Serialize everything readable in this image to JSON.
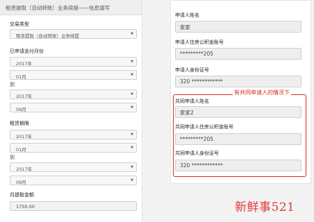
{
  "left_panel": {
    "header": "租赁提取（自动转账）业务续提——信息填写",
    "transaction_type": {
      "label": "交易类型",
      "value": "租赁提取（自动转账）业务续提"
    },
    "paid_month": {
      "label": "已申请支付月份",
      "start_year": "2017年",
      "start_month": "01月",
      "to": "到",
      "end_year": "2017年",
      "end_month": "09月"
    },
    "lease_period": {
      "label": "租赁期限",
      "start_year": "2017年",
      "start_month": "01月",
      "to": "到",
      "end_year": "2017年",
      "end_month": "09月"
    },
    "monthly_amount": {
      "label": "月提取金额",
      "value": "1750.00"
    }
  },
  "right_panel": {
    "applicant_name": {
      "label": "申请人姓名",
      "value": "家家"
    },
    "applicant_account": {
      "label": "申请人住房公积金账号",
      "value": "*********205"
    },
    "applicant_id": {
      "label": "申请人身份证号",
      "value": "320 ************"
    },
    "co_name": {
      "label": "共同申请人姓名",
      "value": "家家2"
    },
    "co_account": {
      "label": "共同申请人住房公积金账号",
      "value": "*********205"
    },
    "co_id": {
      "label": "共同申请人身份证号",
      "value": "320 ************"
    }
  },
  "annotation": "有共同申请人的情况下",
  "watermark": "新鲜事521",
  "colors": {
    "highlight": "#d9281d"
  }
}
